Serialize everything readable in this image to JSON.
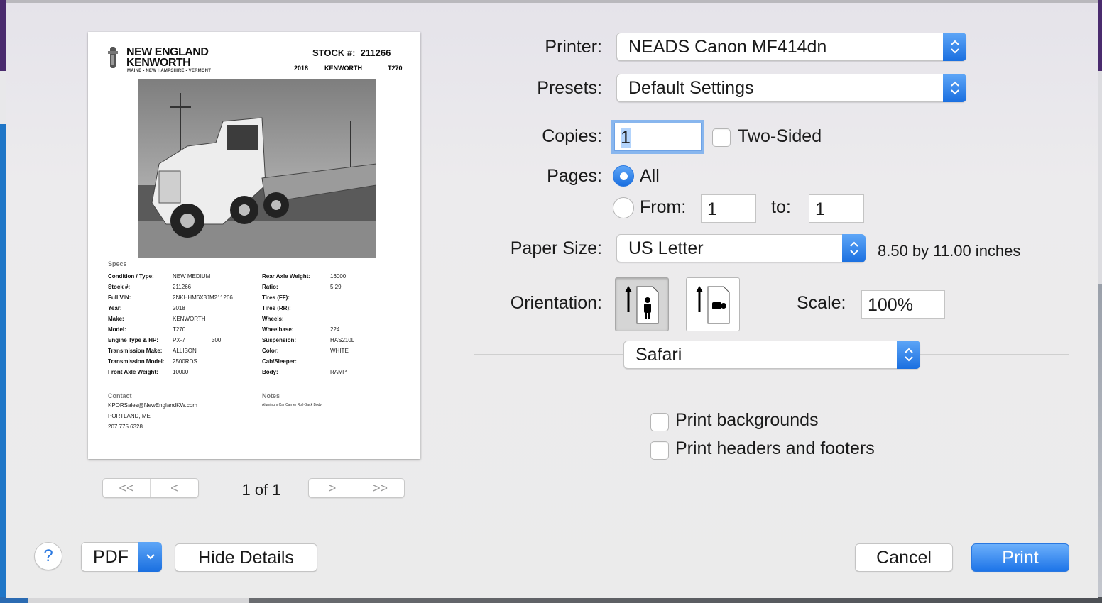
{
  "preview": {
    "logo_line1": "NEW ENGLAND",
    "logo_line2": "KENWORTH",
    "logo_sub": "MAINE • NEW HAMPSHIRE • VERMONT",
    "stock_label": "STOCK #:",
    "stock_number": "211266",
    "year": "2018",
    "make": "KENWORTH",
    "model": "T270",
    "specs_title": "Specs",
    "specs_left": [
      {
        "key": "Condition / Type:",
        "value": "NEW MEDIUM"
      },
      {
        "key": "Stock #:",
        "value": "211266"
      },
      {
        "key": "Full VIN:",
        "value": "2NKHHM6X3JM211266"
      },
      {
        "key": "Year:",
        "value": "2018"
      },
      {
        "key": "Make:",
        "value": "KENWORTH"
      },
      {
        "key": "Model:",
        "value": "T270"
      },
      {
        "key": "Engine Type & HP:",
        "value": "PX-7",
        "extra": "300"
      },
      {
        "key": "Transmission Make:",
        "value": "ALLISON"
      },
      {
        "key": "Transmission Model:",
        "value": "2500RDS"
      },
      {
        "key": "Front Axle Weight:",
        "value": "10000"
      }
    ],
    "specs_right": [
      {
        "key": "Rear Axle Weight:",
        "value": "16000"
      },
      {
        "key": "Ratio:",
        "value": "5.29"
      },
      {
        "key": "Tires (FF):",
        "value": ""
      },
      {
        "key": "Tires (RR):",
        "value": ""
      },
      {
        "key": "Wheels:",
        "value": ""
      },
      {
        "key": "Wheelbase:",
        "value": "224"
      },
      {
        "key": "Suspension:",
        "value": "HAS210L"
      },
      {
        "key": "Color:",
        "value": "WHITE"
      },
      {
        "key": "Cab/Sleeper:",
        "value": ""
      },
      {
        "key": "Body:",
        "value": "RAMP"
      }
    ],
    "contact_title": "Contact",
    "contact_email": "KPORSales@NewEnglandKW.com",
    "contact_city": "PORTLAND, ME",
    "contact_phone": "207.775.6328",
    "notes_title": "Notes",
    "notes_text": "Aluminum Car Carrier Roll-Back Body"
  },
  "pager": {
    "first": "<<",
    "prev": "<",
    "next": ">",
    "last": ">>",
    "count": "1 of 1"
  },
  "form": {
    "printer_label": "Printer:",
    "printer_value": "NEADS Canon MF414dn",
    "presets_label": "Presets:",
    "presets_value": "Default Settings",
    "copies_label": "Copies:",
    "copies_value": "1",
    "two_sided_label": "Two-Sided",
    "pages_label": "Pages:",
    "pages_all_label": "All",
    "pages_from_label": "From:",
    "pages_from_value": "1",
    "pages_to_label": "to:",
    "pages_to_value": "1",
    "paper_size_label": "Paper Size:",
    "paper_size_value": "US Letter",
    "paper_size_dims": "8.50 by 11.00 inches",
    "orientation_label": "Orientation:",
    "scale_label": "Scale:",
    "scale_value": "100%",
    "app_section_value": "Safari",
    "print_backgrounds_label": "Print backgrounds",
    "print_headers_label": "Print headers and footers"
  },
  "footer": {
    "help": "?",
    "pdf_label": "PDF",
    "hide_details_label": "Hide Details",
    "cancel_label": "Cancel",
    "print_label": "Print"
  },
  "colors": {
    "accent": "#1d74e8",
    "focus_ring": "#88b6ee"
  }
}
